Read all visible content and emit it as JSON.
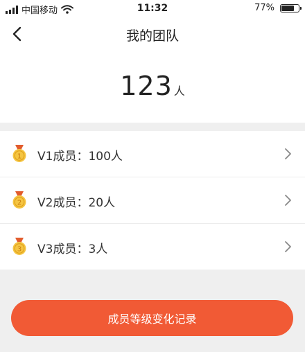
{
  "status_bar": {
    "carrier": "中国移动",
    "time": "11:32",
    "battery_percent": "77%",
    "battery_level": 0.77
  },
  "header": {
    "title": "我的团队"
  },
  "summary": {
    "total_count": "123",
    "unit": "人"
  },
  "members": [
    {
      "level": "1",
      "label": "V1成员：100人",
      "medal_color": "#f5c542"
    },
    {
      "level": "2",
      "label": "V2成员：20人",
      "medal_color": "#f5c542"
    },
    {
      "level": "3",
      "label": "V3成员：3人",
      "medal_color": "#f5c542"
    }
  ],
  "actions": {
    "history_label": "成员等级变化记录"
  },
  "colors": {
    "accent": "#f15a35",
    "background": "#efefef",
    "medal_gold": "#f5c542",
    "medal_ribbon": "#e25c2d"
  }
}
